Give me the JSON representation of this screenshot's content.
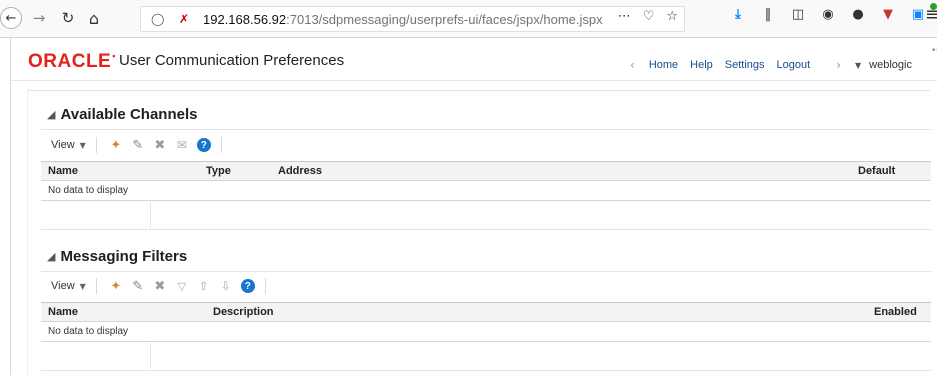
{
  "browser": {
    "url_host": "192.168.56.92",
    "url_rest": ":7013/sdpmessaging/userprefs-ui/faces/jspx/home.jspx"
  },
  "app": {
    "logo_text": "ORACLE",
    "title": "User Communication Preferences",
    "nav": {
      "home": "Home",
      "help": "Help",
      "settings": "Settings",
      "logout": "Logout",
      "user": "weblogic"
    }
  },
  "channels": {
    "title": "Available Channels",
    "view_label": "View",
    "columns": {
      "name": "Name",
      "type": "Type",
      "address": "Address",
      "default": "Default"
    },
    "empty_text": "No data to display"
  },
  "filters": {
    "title": "Messaging Filters",
    "view_label": "View",
    "columns": {
      "name": "Name",
      "description": "Description",
      "enabled": "Enabled"
    },
    "empty_text": "No data to display"
  },
  "colors": {
    "oracle_red": "#e2231a",
    "link_blue": "#1a4e8a",
    "help_blue": "#1874cd"
  }
}
